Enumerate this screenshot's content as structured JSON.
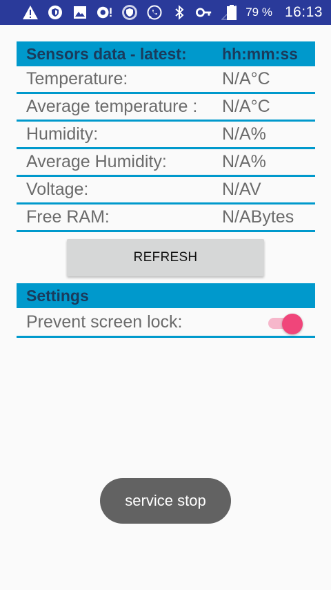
{
  "status_bar": {
    "icons": [
      "warning-icon",
      "shield-icon",
      "image-icon",
      "sync-alert-icon",
      "vpn-shield-icon",
      "whatsapp-icon",
      "bluetooth-icon",
      "key-icon",
      "signal-icon",
      "battery-icon"
    ],
    "battery_percent": "79 %",
    "time": "16:13"
  },
  "sensors": {
    "header_label": "Sensors data - latest:",
    "header_value": "hh:mm:ss",
    "rows": [
      {
        "label": "Temperature:",
        "value": "N/A°C"
      },
      {
        "label": "Average temperature :",
        "value": "N/A°C"
      },
      {
        "label": "Humidity:",
        "value": "N/A%"
      },
      {
        "label": "Average Humidity:",
        "value": "N/A%"
      },
      {
        "label": "Voltage:",
        "value": "N/AV"
      },
      {
        "label": "Free RAM:",
        "value": "N/ABytes"
      }
    ]
  },
  "refresh_label": "REFRESH",
  "settings": {
    "header_label": "Settings",
    "prevent_lock_label": "Prevent screen lock:",
    "prevent_lock_on": true
  },
  "toast_text": "service stop",
  "colors": {
    "accent": "#0099cc",
    "status_bar": "#2a3a9a",
    "switch_on": "#f0457a",
    "toast": "#626262"
  }
}
